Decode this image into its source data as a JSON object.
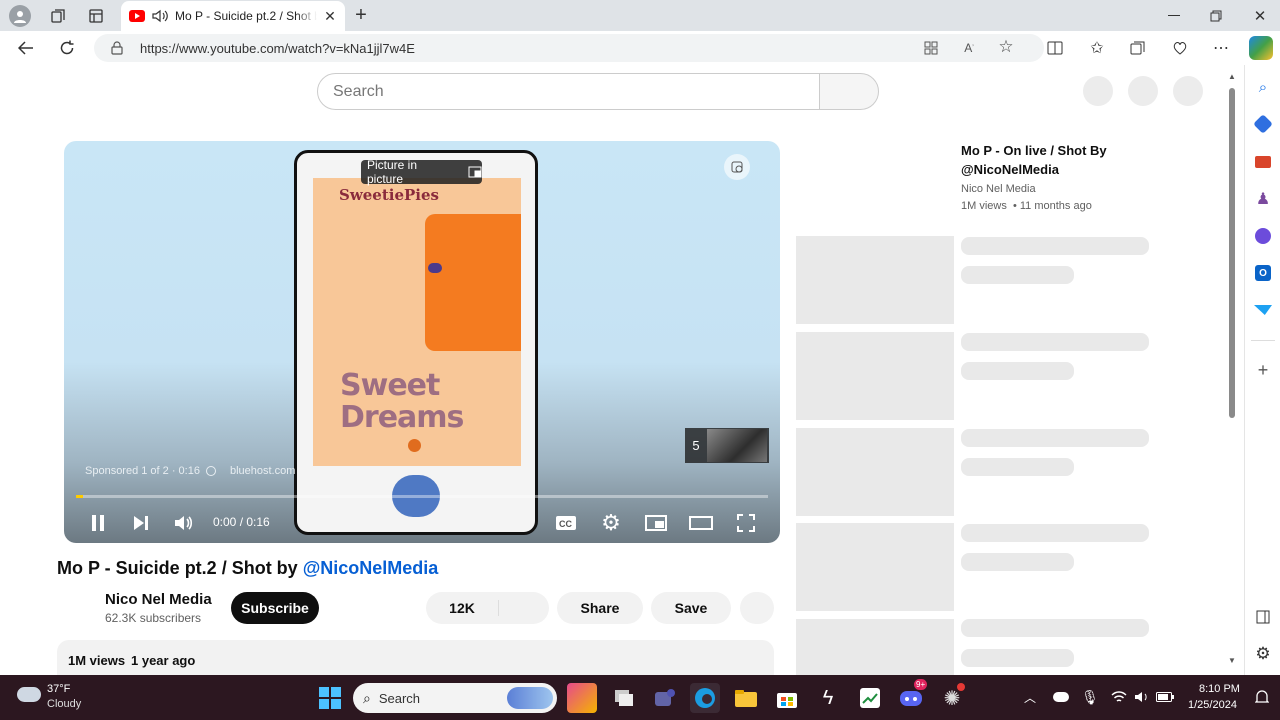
{
  "browser": {
    "tab_title": "Mo P - Suicide pt.2 / Shot by @NicoNelMedia",
    "url": "https://www.youtube.com/watch?v=kNa1jjl7w4E",
    "new_tab": "+"
  },
  "youtube": {
    "search_placeholder": "Search",
    "video": {
      "title_prefix": "Mo P - Suicide pt.2 / Shot by ",
      "title_handle": "@NicoNelMedia",
      "channel": "Nico Nel Media",
      "subscribers": "62.3K subscribers",
      "subscribe_label": "Subscribe",
      "likes": "12K",
      "share_label": "Share",
      "save_label": "Save",
      "views": "1M views",
      "age": "1 year ago"
    },
    "player": {
      "pip_tooltip": "Picture in picture",
      "ad_brand_top": "SweetiePies",
      "ad_line1": "Sweet",
      "ad_line2": "Dreams",
      "sponsored": "Sponsored 1 of 2 · 0:16",
      "ad_domain": "bluehost.com",
      "skip_count": "5",
      "time": "0:00 / 0:16",
      "progress": 0.01
    },
    "recommendation": {
      "title": "Mo P - On live / Shot By @NicoNelMedia",
      "channel": "Nico Nel Media",
      "meta": "1M views  • 11 months ago"
    }
  },
  "taskbar": {
    "weather_temp": "37°F",
    "weather_desc": "Cloudy",
    "search_label": "Search",
    "time": "8:10 PM",
    "date": "1/25/2024",
    "discord_badge": "9+"
  }
}
